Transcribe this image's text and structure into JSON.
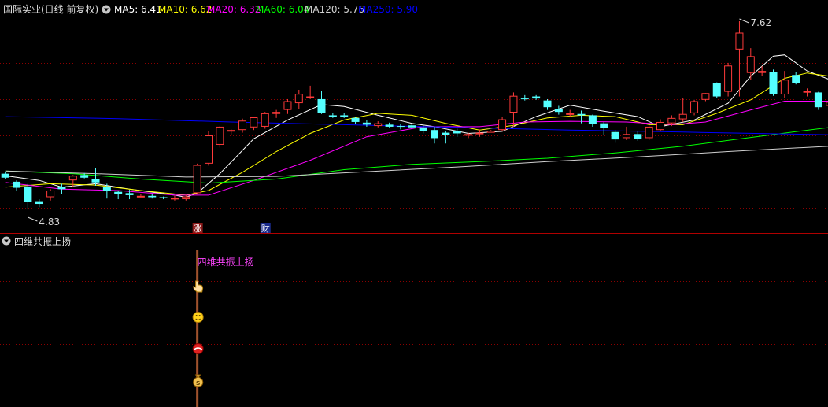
{
  "main_panel": {
    "title": "国际实业(日线 前复权)",
    "ma_legend": [
      {
        "label": "MA5: 6.41",
        "color": "#ffffff"
      },
      {
        "label": "MA10: 6.62",
        "color": "#ffff00"
      },
      {
        "label": "MA20: 6.32",
        "color": "#ff00ff"
      },
      {
        "label": "MA60: 6.04",
        "color": "#00ff00"
      },
      {
        "label": "MA120: 5.76",
        "color": "#d0d0d0"
      },
      {
        "label": "MA250: 5.90",
        "color": "#0000ff"
      }
    ],
    "high_label": "7.62",
    "low_label": "4.83",
    "markers": [
      {
        "text": "涨",
        "candle_index": 17,
        "bg": "#8b1a1a",
        "color": "#ffffff"
      },
      {
        "text": "财",
        "candle_index": 23,
        "bg": "#1a2a8b",
        "color": "#ffffff"
      }
    ]
  },
  "sub_panel": {
    "title": "四维共振上扬",
    "signal_label": "四维共振上扬",
    "signal_candle_index": 17,
    "signal_icons": [
      "hand-pointer-icon",
      "smiley-icon",
      "red-ball-icon",
      "money-bag-icon"
    ]
  },
  "colors": {
    "background": "#000000",
    "grid": "#8b0000",
    "up": "#ff3a3a",
    "down": "#54ffff",
    "separator": "#b00000"
  },
  "chart_data": {
    "type": "candlestick",
    "y_range": [
      4.6,
      7.9
    ],
    "candles": [
      {
        "o": 5.35,
        "h": 5.38,
        "l": 5.27,
        "c": 5.29
      },
      {
        "o": 5.23,
        "h": 5.25,
        "l": 5.1,
        "c": 5.14
      },
      {
        "o": 5.16,
        "h": 5.2,
        "l": 4.83,
        "c": 4.93
      },
      {
        "o": 4.94,
        "h": 4.97,
        "l": 4.85,
        "c": 4.9
      },
      {
        "o": 5.0,
        "h": 5.12,
        "l": 4.95,
        "c": 5.1
      },
      {
        "o": 5.15,
        "h": 5.2,
        "l": 5.05,
        "c": 5.12
      },
      {
        "o": 5.25,
        "h": 5.33,
        "l": 5.15,
        "c": 5.32
      },
      {
        "o": 5.33,
        "h": 5.36,
        "l": 5.28,
        "c": 5.29
      },
      {
        "o": 5.27,
        "h": 5.44,
        "l": 5.17,
        "c": 5.22
      },
      {
        "o": 5.15,
        "h": 5.2,
        "l": 4.98,
        "c": 5.09
      },
      {
        "o": 5.08,
        "h": 5.1,
        "l": 4.97,
        "c": 5.05
      },
      {
        "o": 5.06,
        "h": 5.11,
        "l": 4.97,
        "c": 5.03
      },
      {
        "o": 5.0,
        "h": 5.05,
        "l": 5.02,
        "c": 5.02
      },
      {
        "o": 5.02,
        "h": 5.05,
        "l": 4.98,
        "c": 5.0
      },
      {
        "o": 5.0,
        "h": 5.01,
        "l": 4.97,
        "c": 4.99
      },
      {
        "o": 4.99,
        "h": 5.02,
        "l": 4.95,
        "c": 4.99
      },
      {
        "o": 4.97,
        "h": 5.03,
        "l": 4.95,
        "c": 5.01
      },
      {
        "o": 5.06,
        "h": 5.5,
        "l": 5.04,
        "c": 5.48
      },
      {
        "o": 5.5,
        "h": 5.98,
        "l": 5.47,
        "c": 5.92
      },
      {
        "o": 5.78,
        "h": 6.06,
        "l": 5.74,
        "c": 6.05
      },
      {
        "o": 5.98,
        "h": 6.01,
        "l": 5.92,
        "c": 6.0
      },
      {
        "o": 6.0,
        "h": 6.17,
        "l": 5.96,
        "c": 6.14
      },
      {
        "o": 6.04,
        "h": 6.2,
        "l": 6.0,
        "c": 6.19
      },
      {
        "o": 6.05,
        "h": 6.27,
        "l": 6.02,
        "c": 6.25
      },
      {
        "o": 6.24,
        "h": 6.3,
        "l": 6.18,
        "c": 6.27
      },
      {
        "o": 6.3,
        "h": 6.46,
        "l": 6.24,
        "c": 6.43
      },
      {
        "o": 6.4,
        "h": 6.6,
        "l": 6.31,
        "c": 6.54
      },
      {
        "o": 6.5,
        "h": 6.66,
        "l": 6.46,
        "c": 6.5
      },
      {
        "o": 6.46,
        "h": 6.58,
        "l": 6.24,
        "c": 6.25
      },
      {
        "o": 6.22,
        "h": 6.26,
        "l": 6.18,
        "c": 6.2
      },
      {
        "o": 6.22,
        "h": 6.25,
        "l": 6.18,
        "c": 6.2
      },
      {
        "o": 6.18,
        "h": 6.2,
        "l": 6.09,
        "c": 6.12
      },
      {
        "o": 6.11,
        "h": 6.15,
        "l": 6.05,
        "c": 6.08
      },
      {
        "o": 6.06,
        "h": 6.13,
        "l": 6.04,
        "c": 6.1
      },
      {
        "o": 6.08,
        "h": 6.11,
        "l": 6.04,
        "c": 6.05
      },
      {
        "o": 6.06,
        "h": 6.09,
        "l": 6.01,
        "c": 6.05
      },
      {
        "o": 6.07,
        "h": 6.09,
        "l": 6.03,
        "c": 6.04
      },
      {
        "o": 6.04,
        "h": 6.07,
        "l": 5.95,
        "c": 5.99
      },
      {
        "o": 6.0,
        "h": 6.05,
        "l": 5.8,
        "c": 5.88
      },
      {
        "o": 5.96,
        "h": 5.99,
        "l": 5.8,
        "c": 5.93
      },
      {
        "o": 5.99,
        "h": 6.02,
        "l": 5.9,
        "c": 5.95
      },
      {
        "o": 5.93,
        "h": 5.96,
        "l": 5.88,
        "c": 5.94
      },
      {
        "o": 5.96,
        "h": 6.01,
        "l": 5.9,
        "c": 5.96
      },
      {
        "o": 5.96,
        "h": 6.0,
        "l": 5.97,
        "c": 5.99
      },
      {
        "o": 6.0,
        "h": 6.2,
        "l": 5.99,
        "c": 6.16
      },
      {
        "o": 6.26,
        "h": 6.56,
        "l": 6.05,
        "c": 6.51
      },
      {
        "o": 6.47,
        "h": 6.52,
        "l": 6.44,
        "c": 6.46
      },
      {
        "o": 6.5,
        "h": 6.52,
        "l": 6.45,
        "c": 6.47
      },
      {
        "o": 6.44,
        "h": 6.46,
        "l": 6.3,
        "c": 6.34
      },
      {
        "o": 6.31,
        "h": 6.36,
        "l": 6.23,
        "c": 6.27
      },
      {
        "o": 6.25,
        "h": 6.3,
        "l": 6.2,
        "c": 6.25
      },
      {
        "o": 6.24,
        "h": 6.29,
        "l": 6.1,
        "c": 6.22
      },
      {
        "o": 6.22,
        "h": 6.23,
        "l": 6.05,
        "c": 6.09
      },
      {
        "o": 6.1,
        "h": 6.12,
        "l": 5.93,
        "c": 6.03
      },
      {
        "o": 5.97,
        "h": 6.0,
        "l": 5.81,
        "c": 5.86
      },
      {
        "o": 5.88,
        "h": 6.05,
        "l": 5.85,
        "c": 5.94
      },
      {
        "o": 5.94,
        "h": 5.98,
        "l": 5.84,
        "c": 5.87
      },
      {
        "o": 5.88,
        "h": 6.08,
        "l": 5.85,
        "c": 6.05
      },
      {
        "o": 6.0,
        "h": 6.16,
        "l": 5.98,
        "c": 6.12
      },
      {
        "o": 6.1,
        "h": 6.22,
        "l": 6.06,
        "c": 6.18
      },
      {
        "o": 6.16,
        "h": 6.48,
        "l": 6.12,
        "c": 6.24
      },
      {
        "o": 6.25,
        "h": 6.45,
        "l": 6.22,
        "c": 6.43
      },
      {
        "o": 6.45,
        "h": 6.55,
        "l": 6.43,
        "c": 6.55
      },
      {
        "o": 6.7,
        "h": 6.71,
        "l": 6.48,
        "c": 6.5
      },
      {
        "o": 6.57,
        "h": 7.0,
        "l": 6.5,
        "c": 6.96
      },
      {
        "o": 7.2,
        "h": 7.62,
        "l": 6.5,
        "c": 7.45
      },
      {
        "o": 6.85,
        "h": 7.22,
        "l": 6.75,
        "c": 7.1
      },
      {
        "o": 6.85,
        "h": 6.95,
        "l": 6.8,
        "c": 6.88
      },
      {
        "o": 6.86,
        "h": 6.9,
        "l": 6.51,
        "c": 6.53
      },
      {
        "o": 6.53,
        "h": 6.88,
        "l": 6.48,
        "c": 6.75
      },
      {
        "o": 6.82,
        "h": 6.86,
        "l": 6.68,
        "c": 6.7
      },
      {
        "o": 6.58,
        "h": 6.62,
        "l": 6.5,
        "c": 6.58
      },
      {
        "o": 6.56,
        "h": 6.57,
        "l": 6.3,
        "c": 6.34
      },
      {
        "o": 6.36,
        "h": 6.43,
        "l": 6.27,
        "c": 6.42
      }
    ],
    "ma_lines": [
      {
        "name": "MA5",
        "color": "#ffffff",
        "values": [
          [
            0,
            5.32
          ],
          [
            3,
            5.25
          ],
          [
            5,
            5.15
          ],
          [
            8,
            5.2
          ],
          [
            11,
            5.12
          ],
          [
            15,
            5.03
          ],
          [
            16,
            5.0
          ],
          [
            17,
            5.06
          ],
          [
            19,
            5.35
          ],
          [
            22,
            5.87
          ],
          [
            25,
            6.15
          ],
          [
            28,
            6.38
          ],
          [
            30,
            6.35
          ],
          [
            33,
            6.22
          ],
          [
            36,
            6.1
          ],
          [
            38,
            6.05
          ],
          [
            41,
            5.95
          ],
          [
            44,
            5.98
          ],
          [
            47,
            6.2
          ],
          [
            50,
            6.37
          ],
          [
            53,
            6.28
          ],
          [
            56,
            6.2
          ],
          [
            58,
            6.05
          ],
          [
            61,
            6.15
          ],
          [
            64,
            6.4
          ],
          [
            66,
            6.8
          ],
          [
            68,
            7.1
          ],
          [
            69,
            7.12
          ],
          [
            71,
            6.88
          ],
          [
            73,
            6.75
          ]
        ]
      },
      {
        "name": "MA10",
        "color": "#ffff00",
        "values": [
          [
            0,
            5.15
          ],
          [
            4,
            5.2
          ],
          [
            8,
            5.18
          ],
          [
            12,
            5.1
          ],
          [
            16,
            5.03
          ],
          [
            18,
            5.1
          ],
          [
            21,
            5.37
          ],
          [
            24,
            5.68
          ],
          [
            27,
            5.95
          ],
          [
            30,
            6.15
          ],
          [
            33,
            6.25
          ],
          [
            36,
            6.22
          ],
          [
            39,
            6.1
          ],
          [
            42,
            6.0
          ],
          [
            45,
            6.07
          ],
          [
            48,
            6.18
          ],
          [
            51,
            6.22
          ],
          [
            54,
            6.2
          ],
          [
            57,
            6.08
          ],
          [
            60,
            6.08
          ],
          [
            63,
            6.25
          ],
          [
            66,
            6.45
          ],
          [
            69,
            6.77
          ],
          [
            71,
            6.85
          ],
          [
            73,
            6.8
          ]
        ]
      },
      {
        "name": "MA20",
        "color": "#ff00ff",
        "values": [
          [
            0,
            5.22
          ],
          [
            5,
            5.12
          ],
          [
            10,
            5.1
          ],
          [
            15,
            5.03
          ],
          [
            18,
            5.03
          ],
          [
            22,
            5.25
          ],
          [
            27,
            5.55
          ],
          [
            32,
            5.9
          ],
          [
            37,
            6.05
          ],
          [
            42,
            6.05
          ],
          [
            46,
            6.12
          ],
          [
            50,
            6.13
          ],
          [
            55,
            6.12
          ],
          [
            59,
            6.08
          ],
          [
            62,
            6.12
          ],
          [
            66,
            6.3
          ],
          [
            69,
            6.43
          ],
          [
            73,
            6.43
          ]
        ]
      },
      {
        "name": "MA60",
        "color": "#00ff00",
        "values": [
          [
            0,
            5.39
          ],
          [
            6,
            5.35
          ],
          [
            12,
            5.27
          ],
          [
            18,
            5.21
          ],
          [
            24,
            5.27
          ],
          [
            30,
            5.41
          ],
          [
            36,
            5.49
          ],
          [
            42,
            5.53
          ],
          [
            48,
            5.58
          ],
          [
            54,
            5.66
          ],
          [
            60,
            5.76
          ],
          [
            66,
            5.89
          ],
          [
            73,
            6.04
          ]
        ]
      },
      {
        "name": "MA120",
        "color": "#d0d0d0",
        "values": [
          [
            0,
            5.39
          ],
          [
            8,
            5.35
          ],
          [
            16,
            5.3
          ],
          [
            24,
            5.31
          ],
          [
            32,
            5.38
          ],
          [
            40,
            5.45
          ],
          [
            48,
            5.53
          ],
          [
            56,
            5.6
          ],
          [
            64,
            5.68
          ],
          [
            73,
            5.76
          ]
        ]
      },
      {
        "name": "MA250",
        "color": "#0000ff",
        "values": [
          [
            0,
            6.2
          ],
          [
            10,
            6.17
          ],
          [
            20,
            6.12
          ],
          [
            30,
            6.08
          ],
          [
            40,
            6.04
          ],
          [
            50,
            6.0
          ],
          [
            60,
            5.97
          ],
          [
            73,
            5.93
          ]
        ]
      }
    ]
  }
}
